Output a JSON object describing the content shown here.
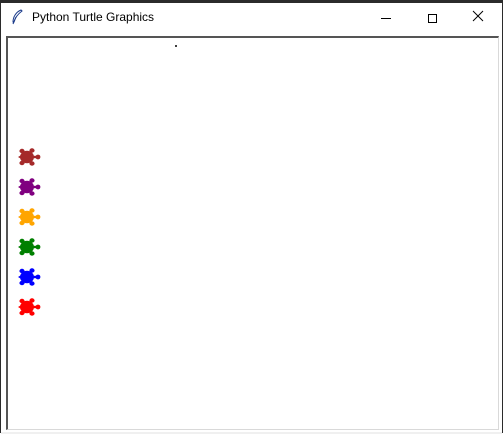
{
  "window": {
    "title": "Python Turtle Graphics",
    "icon": "feather-icon"
  },
  "controls": {
    "minimize_icon": "minimize-icon",
    "maximize_icon": "maximize-icon",
    "close_icon": "close-icon"
  },
  "canvas": {
    "background": "#ffffff",
    "pen_dot_color": "#000000",
    "turtles": [
      {
        "name": "turtle-brown",
        "color": "#a52a2a"
      },
      {
        "name": "turtle-purple",
        "color": "#800080"
      },
      {
        "name": "turtle-orange",
        "color": "#ffa500"
      },
      {
        "name": "turtle-green",
        "color": "#008000"
      },
      {
        "name": "turtle-blue",
        "color": "#0000ff"
      },
      {
        "name": "turtle-red",
        "color": "#ff0000"
      }
    ]
  }
}
